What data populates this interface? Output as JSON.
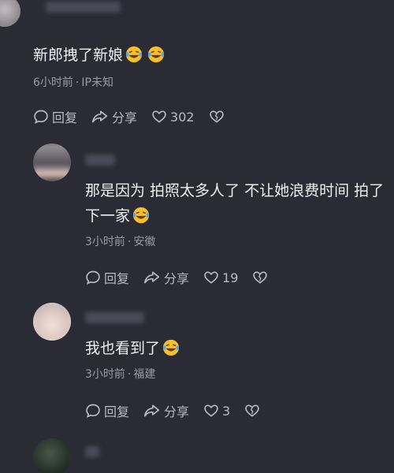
{
  "comments": [
    {
      "text": "新郎拽了新娘",
      "emoji_icons": [
        "laughing-tears-icon",
        "laughing-tears-icon"
      ],
      "time": "6小时前",
      "location": "IP未知",
      "reply_label": "回复",
      "share_label": "分享",
      "like_count": "302"
    },
    {
      "text_line1": "那是因为 拍照太多人了 不让她浪费时间 拍了",
      "text_line2": "下一家",
      "emoji_icons": [
        "laughing-tears-icon"
      ],
      "time": "3小时前",
      "location": "安徽",
      "reply_label": "回复",
      "share_label": "分享",
      "like_count": "19"
    },
    {
      "text": "我也看到了",
      "emoji_icons": [
        "laughing-tears-icon"
      ],
      "time": "3小时前",
      "location": "福建",
      "reply_label": "回复",
      "share_label": "分享",
      "like_count": "3"
    }
  ],
  "separator": "·",
  "colors": {
    "background": "#2a2b35",
    "text": "#f0f0f3",
    "meta": "#9a9ba6",
    "actions": "#b9bac4",
    "emoji": "#f5c02a"
  }
}
